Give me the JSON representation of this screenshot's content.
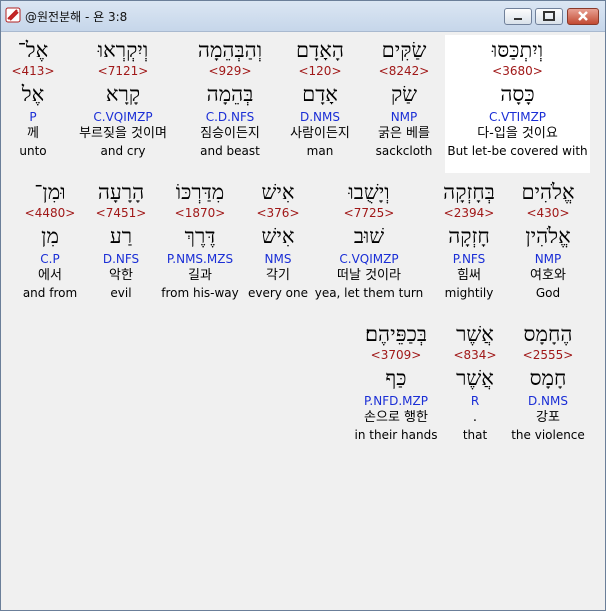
{
  "window": {
    "title": "@원전분해 - 욘 3:8",
    "buttons": {
      "minimize": "minimize",
      "maximize": "maximize",
      "close": "close"
    }
  },
  "rows": [
    [
      {
        "heb": "וְיִתְכַּסּוּ",
        "num": "<3680>",
        "lex": "כָּסָה",
        "morph": "C.VTIMZP",
        "kor": "다-입을 것이요",
        "eng": "But let-be covered with",
        "highlight": true
      },
      {
        "heb": "שַׂקִּים",
        "num": "<8242>",
        "lex": "שַׂק",
        "morph": "NMP",
        "kor": "굵은 베를",
        "eng": "sackcloth"
      },
      {
        "heb": "הָאָדָם",
        "num": "<120>",
        "lex": "אָדָם",
        "morph": "D.NMS",
        "kor": "사람이든지",
        "eng": "man"
      },
      {
        "heb": "וְהַבְּהֵמָה",
        "num": "<929>",
        "lex": "בְּהֵמָה",
        "morph": "C.D.NFS",
        "kor": "짐승이든지",
        "eng": "and beast"
      },
      {
        "heb": "וְיִקְרְאוּ",
        "num": "<7121>",
        "lex": "קָרָא",
        "morph": "C.VQIMZP",
        "kor": "부르짖을 것이며",
        "eng": "and cry"
      },
      {
        "heb": "אֶל־",
        "num": "<413>",
        "lex": "אֶל",
        "morph": "P",
        "kor": "께",
        "eng": "unto"
      }
    ],
    [
      {
        "heb": "אֱלֹהִים",
        "num": "<430>",
        "lex": "אֱלֹהִין",
        "morph": "NMP",
        "kor": "여호와",
        "eng": "God"
      },
      {
        "heb": "בְּחָזְקָה",
        "num": "<2394>",
        "lex": "חָזְקָה",
        "morph": "P.NFS",
        "kor": "힘써",
        "eng": "mightily"
      },
      {
        "heb": "וְיָשֻׁבוּ",
        "num": "<7725>",
        "lex": "שׁוּב",
        "morph": "C.VQIMZP",
        "kor": "떠날 것이라",
        "eng": "yea, let them turn"
      },
      {
        "heb": "אִישׁ",
        "num": "<376>",
        "lex": "אִישׁ",
        "morph": "NMS",
        "kor": "각기",
        "eng": "every one"
      },
      {
        "heb": "מִדַּרְכּוֹ",
        "num": "<1870>",
        "lex": "דֶּרֶךְ",
        "morph": "P.NMS.MZS",
        "kor": "길과",
        "eng": "from his-way"
      },
      {
        "heb": "הָרָעָה",
        "num": "<7451>",
        "lex": "רַע",
        "morph": "D.NFS",
        "kor": "악한",
        "eng": "evil"
      },
      {
        "heb": "וּמִן־",
        "num": "<4480>",
        "lex": "מִן",
        "morph": "C.P",
        "kor": "에서",
        "eng": "and from"
      }
    ],
    [
      {
        "heb": "הֶחָמָס",
        "num": "<2555>",
        "lex": "חָמָס",
        "morph": "D.NMS",
        "kor": "강포",
        "eng": "the violence"
      },
      {
        "heb": "אֲשֶׁר",
        "num": "<834>",
        "lex": "אֲשֶׁר",
        "morph": "R",
        "kor": ".",
        "eng": "that"
      },
      {
        "heb": "בְּכַפֵּיהֶם׃",
        "num": "<3709>",
        "lex": "כַּף",
        "morph": "P.NFD.MZP",
        "kor": "손으로 행한",
        "eng": "in their hands"
      }
    ]
  ],
  "colors": {
    "number": "#a01818",
    "morph": "#1a2ed6",
    "highlight": "#ffffff"
  }
}
